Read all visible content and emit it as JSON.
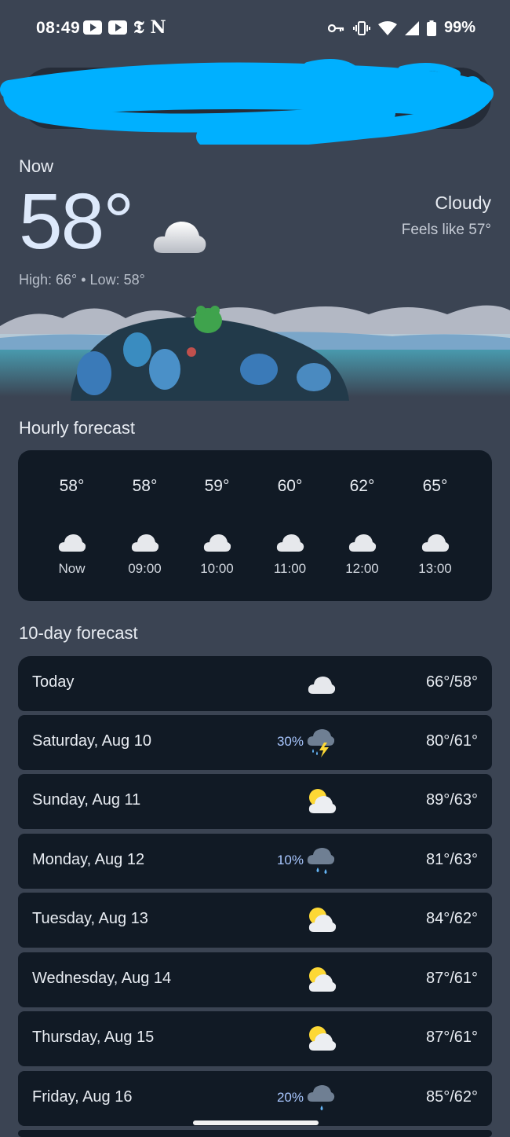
{
  "status_bar": {
    "time": "08:49",
    "left_icons": [
      "youtube-icon",
      "youtube-icon",
      "nytimes-icon",
      "netflix-icon"
    ],
    "nyt_glyph": "𝕿",
    "netflix_glyph": "N",
    "right_icons": [
      "vpn-key-icon",
      "vibrate-icon",
      "wifi-icon",
      "signal-icon",
      "battery-icon"
    ],
    "battery": "99%"
  },
  "current": {
    "label": "Now",
    "temperature": "58°",
    "condition": "Cloudy",
    "feels_like": "Feels like 57°",
    "high_low": "High: 66° • Low: 58°"
  },
  "hourly": {
    "title": "Hourly forecast",
    "items": [
      {
        "temp": "58°",
        "time": "Now",
        "icon": "cloud-icon"
      },
      {
        "temp": "58°",
        "time": "09:00",
        "icon": "cloud-icon"
      },
      {
        "temp": "59°",
        "time": "10:00",
        "icon": "cloud-icon"
      },
      {
        "temp": "60°",
        "time": "11:00",
        "icon": "cloud-icon"
      },
      {
        "temp": "62°",
        "time": "12:00",
        "icon": "cloud-icon"
      },
      {
        "temp": "65°",
        "time": "13:00",
        "icon": "cloud-icon"
      }
    ]
  },
  "daily": {
    "title": "10-day forecast",
    "items": [
      {
        "day": "Today",
        "precip": "",
        "temps": "66°/58°",
        "icon": "cloud-icon"
      },
      {
        "day": "Saturday, Aug 10",
        "precip": "30%",
        "temps": "80°/61°",
        "icon": "thunderstorm-icon"
      },
      {
        "day": "Sunday, Aug 11",
        "precip": "",
        "temps": "89°/63°",
        "icon": "partly-cloudy-icon"
      },
      {
        "day": "Monday, Aug 12",
        "precip": "10%",
        "temps": "81°/63°",
        "icon": "rain-icon"
      },
      {
        "day": "Tuesday, Aug 13",
        "precip": "",
        "temps": "84°/62°",
        "icon": "partly-cloudy-icon"
      },
      {
        "day": "Wednesday, Aug 14",
        "precip": "",
        "temps": "87°/61°",
        "icon": "partly-cloudy-icon"
      },
      {
        "day": "Thursday, Aug 15",
        "precip": "",
        "temps": "87°/61°",
        "icon": "partly-cloudy-icon"
      },
      {
        "day": "Friday, Aug 16",
        "precip": "20%",
        "temps": "85°/62°",
        "icon": "rain-icon"
      }
    ]
  },
  "colors": {
    "background": "#3b4453",
    "card": "#111a25",
    "redaction": "#00b0ff",
    "temperature_text": "#dde9fb",
    "precip_text": "#a9c7ff"
  }
}
